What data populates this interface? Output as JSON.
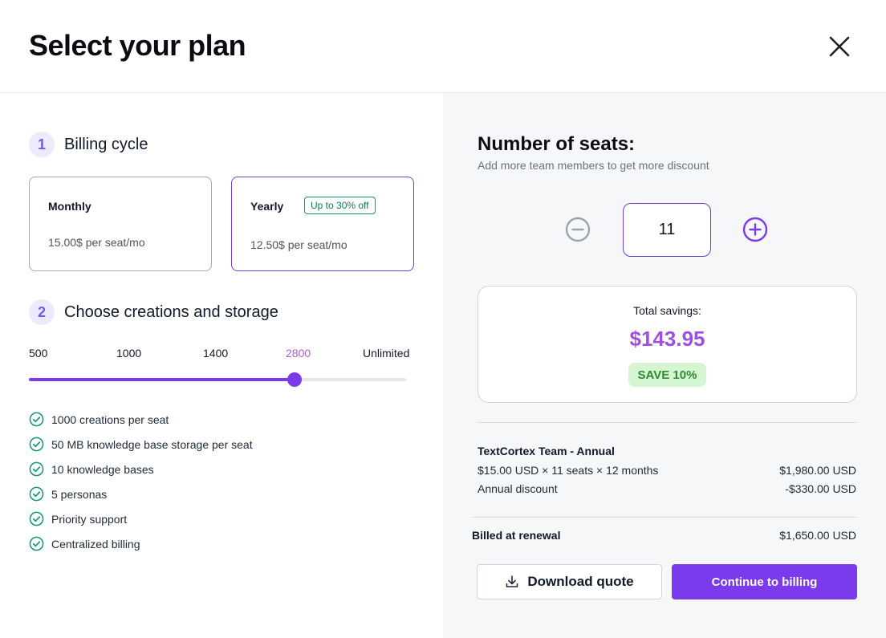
{
  "header": {
    "title": "Select your plan",
    "close_icon": "close-icon"
  },
  "billing": {
    "step_number": "1",
    "step_label": "Billing cycle",
    "options": [
      {
        "name": "Monthly",
        "price": "15.00$ per seat/mo",
        "selected": false
      },
      {
        "name": "Yearly",
        "price": "12.50$ per seat/mo",
        "badge": "Up to 30% off",
        "selected": true
      }
    ]
  },
  "storage": {
    "step_number": "2",
    "step_label": "Choose creations and storage",
    "slider": {
      "stops": [
        "500",
        "1000",
        "1400",
        "2800",
        "Unlimited"
      ],
      "selected": "2800",
      "selected_index": 3,
      "fill_fraction": 0.705
    },
    "features": [
      "1000 creations per seat",
      "50 MB knowledge base storage per seat",
      "10 knowledge bases",
      "5 personas",
      "Priority support",
      "Centralized billing"
    ]
  },
  "seats": {
    "title": "Number of seats:",
    "subtitle": "Add more team members to get more discount",
    "value": "11",
    "minus_icon": "minus-circle-icon",
    "plus_icon": "plus-circle-icon"
  },
  "savings": {
    "label": "Total savings:",
    "amount": "$143.95",
    "badge": "SAVE 10%"
  },
  "summary": {
    "title": "TextCortex Team - Annual",
    "line_label": "$15.00 USD × 11 seats × 12 months",
    "line_value": "$1,980.00 USD",
    "discount_label": "Annual discount",
    "discount_value": "-$330.00 USD",
    "billed_label": "Billed at renewal",
    "billed_value": "$1,650.00 USD"
  },
  "actions": {
    "download_label": "Download quote",
    "download_icon": "download-icon",
    "continue_label": "Continue to billing"
  },
  "colors": {
    "accent": "#7c3aed",
    "badge_green": "#10966a",
    "save_bg": "#d5f5d3",
    "save_text": "#2f8a2f",
    "step_bg": "#ecebfd"
  }
}
